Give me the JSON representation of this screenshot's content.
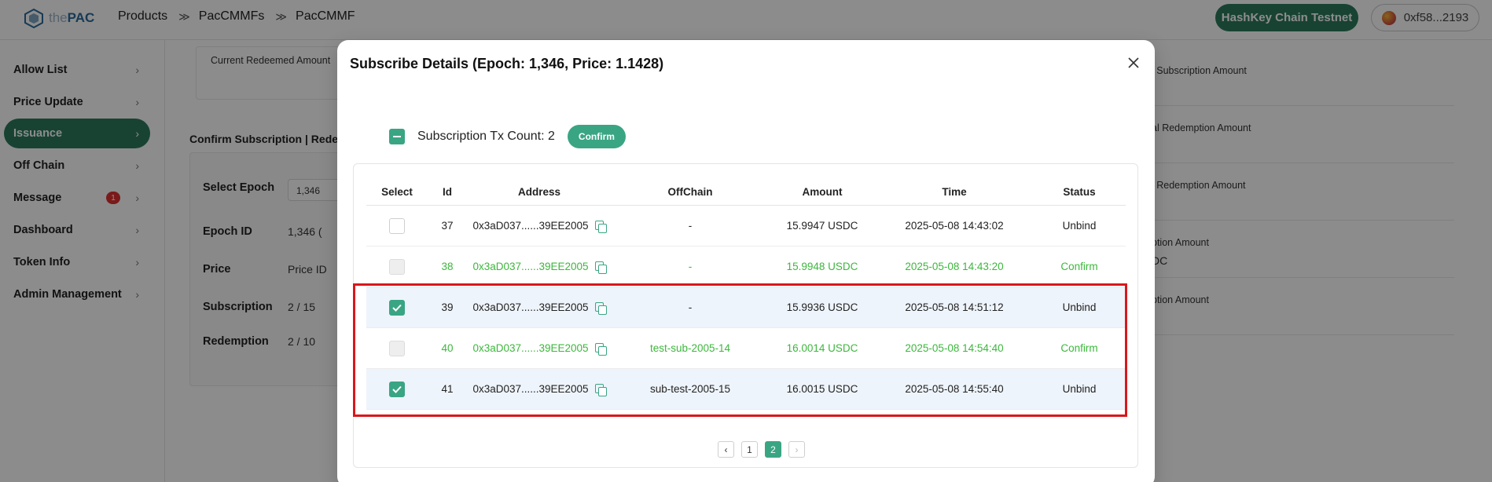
{
  "header": {
    "logo_prefix": "the",
    "logo_text": "PAC",
    "breadcrumbs": [
      "Products",
      "PacCMMFs",
      "PacCMMF"
    ],
    "breadcrumb_separator": "≫",
    "network_label": "HashKey Chain Testnet",
    "wallet_address": "0xf58...2193"
  },
  "sidebar": {
    "items": [
      {
        "label": "Allow List"
      },
      {
        "label": "Price Update"
      },
      {
        "label": "Issuance",
        "active": true
      },
      {
        "label": "Off Chain"
      },
      {
        "label": "Message",
        "badge": "1"
      },
      {
        "label": "Dashboard"
      },
      {
        "label": "Token Info"
      },
      {
        "label": "Admin Management"
      }
    ]
  },
  "background": {
    "current_redeemed_label": "Current Redeemed Amount",
    "confirm_heading": "Confirm Subscription | Redem",
    "select_epoch_label": "Select Epoch",
    "select_epoch_value": "1,346",
    "epoch_id_label": "Epoch ID",
    "epoch_id_value": "1,346 (",
    "price_label": "Price",
    "price_value": "Price ID",
    "subscription_label": "Subscription",
    "subscription_value": "2 / 15",
    "redemption_label": "Redemption",
    "redemption_value": "2 / 10",
    "right_fields": [
      {
        "label": "l Subscription Amount",
        "value": ""
      },
      {
        "label": "al Redemption Amount",
        "value": ""
      },
      {
        "label": "l Redemption Amount",
        "value": ""
      },
      {
        "label": "ption Amount",
        "value": "DC"
      },
      {
        "label": "ption Amount",
        "value": ""
      }
    ]
  },
  "modal": {
    "title": "Subscribe Details (Epoch: 1,346, Price: 1.1428)",
    "selection_count": "Subscription Tx Count: 2",
    "confirm_label": "Confirm",
    "columns": [
      "Select",
      "Id",
      "Address",
      "OffChain",
      "Amount",
      "Time",
      "Status"
    ],
    "rows": [
      {
        "id": "37",
        "address": "0x3aD037......39EE2005",
        "offchain": "-",
        "amount": "15.9947 USDC",
        "time": "2025-05-08 14:43:02",
        "status": "Unbind"
      },
      {
        "id": "38",
        "address": "0x3aD037......39EE2005",
        "offchain": "-",
        "amount": "15.9948 USDC",
        "time": "2025-05-08 14:43:20",
        "status": "Confirm"
      },
      {
        "id": "39",
        "address": "0x3aD037......39EE2005",
        "offchain": "-",
        "amount": "15.9936 USDC",
        "time": "2025-05-08 14:51:12",
        "status": "Unbind"
      },
      {
        "id": "40",
        "address": "0x3aD037......39EE2005",
        "offchain": "test-sub-2005-14",
        "amount": "16.0014 USDC",
        "time": "2025-05-08 14:54:40",
        "status": "Confirm"
      },
      {
        "id": "41",
        "address": "0x3aD037......39EE2005",
        "offchain": "sub-test-2005-15",
        "amount": "16.0015 USDC",
        "time": "2025-05-08 14:55:40",
        "status": "Unbind"
      }
    ],
    "pagination": {
      "prev": "‹",
      "pages": [
        "1",
        "2"
      ],
      "current": "2",
      "next": "›"
    }
  },
  "colors": {
    "accent": "#3aa583",
    "brand_dark": "#2c7a5e",
    "confirmed_text": "#3cb73c",
    "highlight_border": "#d9171c"
  }
}
